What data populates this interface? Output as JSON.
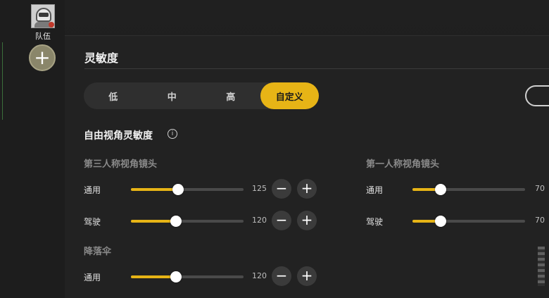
{
  "sidebar": {
    "team_label": "队伍",
    "add_label": "+"
  },
  "panel": {
    "title": "灵敏度",
    "presets": [
      "低",
      "中",
      "高",
      "自定义"
    ],
    "active_preset": "自定义",
    "section_title": "自由视角灵敏度",
    "info_glyph": "i",
    "groups": {
      "third_person": {
        "title": "第三人称视角镜头",
        "rows": [
          {
            "label": "通用",
            "value": "125",
            "fraction": 0.42
          },
          {
            "label": "驾驶",
            "value": "120",
            "fraction": 0.4
          }
        ]
      },
      "first_person": {
        "title": "第一人称视角镜头",
        "rows": [
          {
            "label": "通用",
            "value": "70",
            "fraction": 0.25
          },
          {
            "label": "驾驶",
            "value": "70",
            "fraction": 0.25
          }
        ]
      },
      "parachute": {
        "title": "降落伞",
        "rows": [
          {
            "label": "通用",
            "value": "120",
            "fraction": 0.4
          }
        ]
      }
    },
    "minus_glyph": "−",
    "plus_glyph": "+"
  },
  "colors": {
    "accent": "#e7b416",
    "track": "#4a4a4a",
    "panel_bg": "#222222"
  }
}
